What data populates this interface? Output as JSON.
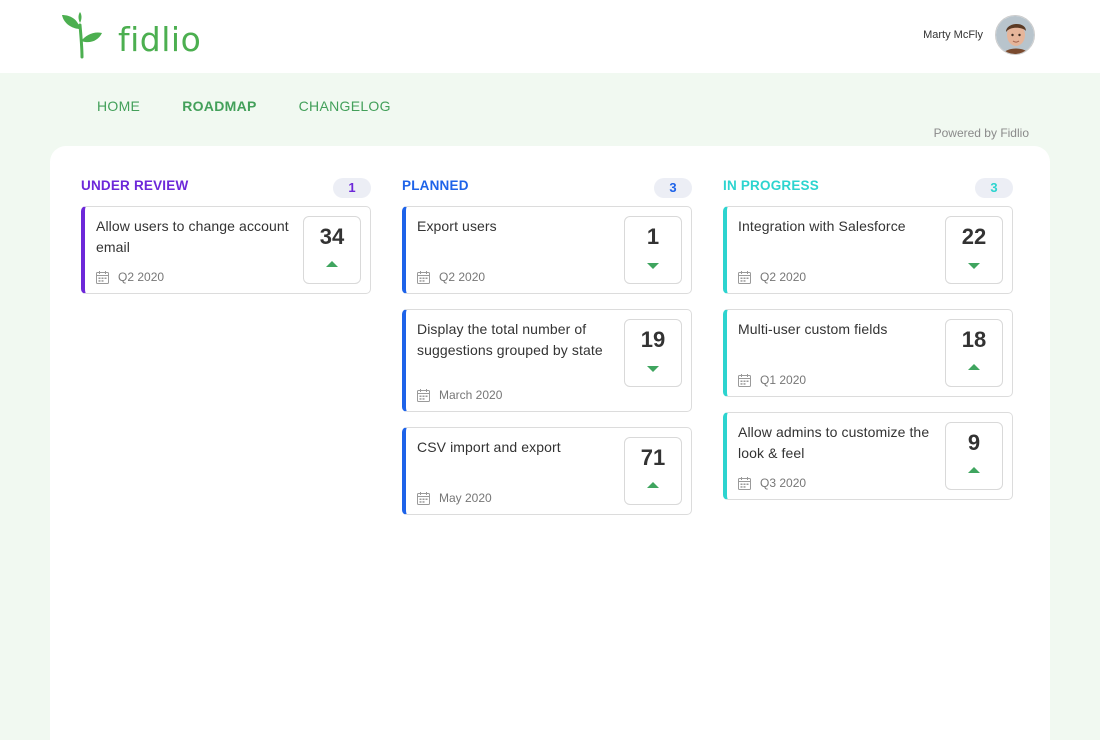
{
  "brand": {
    "name": "fidlio",
    "logo_icon": "sprout-icon",
    "color": "#4caf50"
  },
  "user": {
    "name": "Marty McFly",
    "avatar_icon": "avatar-photo"
  },
  "nav": {
    "items": [
      {
        "label": "HOME",
        "active": false
      },
      {
        "label": "ROADMAP",
        "active": true
      },
      {
        "label": "CHANGELOG",
        "active": false
      }
    ]
  },
  "powered_by": "Powered by Fidlio",
  "columns": [
    {
      "title": "UNDER REVIEW",
      "count": "1",
      "color": "#6d28d9",
      "cards": [
        {
          "title": "Allow users to change account email",
          "date": "Q2 2020",
          "votes": "34",
          "arrow": "up"
        }
      ]
    },
    {
      "title": "PLANNED",
      "count": "3",
      "color": "#1e63e9",
      "cards": [
        {
          "title": "Export users",
          "date": "Q2 2020",
          "votes": "1",
          "arrow": "down"
        },
        {
          "title": "Display the total number of suggestions grouped by state",
          "date": "March 2020",
          "votes": "19",
          "arrow": "down"
        },
        {
          "title": "CSV import and export",
          "date": "May 2020",
          "votes": "71",
          "arrow": "up"
        }
      ]
    },
    {
      "title": "IN PROGRESS",
      "count": "3",
      "color": "#2dd4cf",
      "cards": [
        {
          "title": "Integration with Salesforce",
          "date": "Q2 2020",
          "votes": "22",
          "arrow": "down"
        },
        {
          "title": "Multi-user custom fields",
          "date": "Q1 2020",
          "votes": "18",
          "arrow": "up"
        },
        {
          "title": "Allow admins to customize the look & feel",
          "date": "Q3 2020",
          "votes": "9",
          "arrow": "up"
        }
      ]
    }
  ],
  "colors": {
    "background": "#f1f9f1",
    "accent_green": "#3fa55f"
  }
}
